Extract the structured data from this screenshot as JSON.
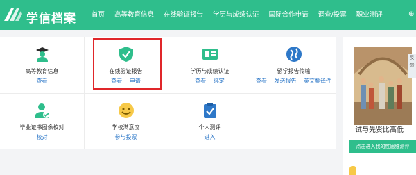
{
  "brand": {
    "name": "学信档案",
    "color": "#2fbe8c"
  },
  "nav": [
    {
      "label": "首页"
    },
    {
      "label": "高等教育信息"
    },
    {
      "label": "在线验证报告"
    },
    {
      "label": "学历与成绩认证"
    },
    {
      "label": "国际合作申请"
    },
    {
      "label": "调查/投票"
    },
    {
      "label": "职业测评"
    }
  ],
  "nav_right_icon": "user-icon",
  "grid": {
    "row1": [
      {
        "label": "高等教育信息",
        "links": [
          "查看"
        ],
        "icon": "graduate-icon"
      },
      {
        "label": "在线验证报告",
        "links": [
          "查看",
          "申请"
        ],
        "icon": "shield-check-icon"
      },
      {
        "label": "学历与成绩认证",
        "links": [
          "查看",
          "绑定"
        ],
        "icon": "id-card-icon"
      },
      {
        "label": "留学报告传输",
        "links": [
          "查看",
          "发送报告",
          "英文翻译件"
        ],
        "icon": "globe-icon"
      }
    ],
    "row2": [
      {
        "label": "毕业证书图像校对",
        "links": [
          "校对"
        ],
        "icon": "user-check-icon"
      },
      {
        "label": "学校满意度",
        "links": [
          "参与投票"
        ],
        "icon": "smiley-icon"
      },
      {
        "label": "个人测评",
        "links": [
          "进入"
        ],
        "icon": "clipboard-check-icon"
      }
    ]
  },
  "side": {
    "caption": "试与先贤比高低",
    "button": "点击进入我的性思维测评",
    "feedback": "反馈"
  },
  "colors": {
    "link": "#2e78c8",
    "highlight": "#e0262a"
  }
}
